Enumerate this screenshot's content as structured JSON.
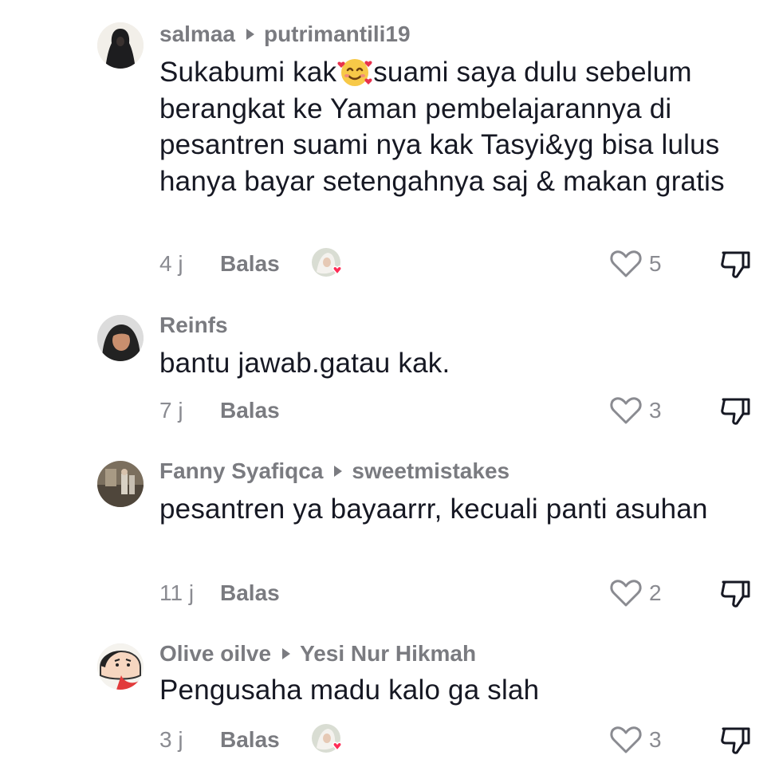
{
  "comments": [
    {
      "author": "salmaa",
      "reply_to": "putrimantili19",
      "text_before_emoji": "Sukabumi kak",
      "emoji": "smiling-face-with-hearts",
      "text_after_emoji": "suami saya dulu sebelum berangkat ke Yaman pembelajarannya di pesantren suami nya kak Tasyi&yg bisa lulus hanya bayar setengahnya saj & makan gratis",
      "time": "4 j",
      "reply_label": "Balas",
      "creator_liked": true,
      "likes": "5"
    },
    {
      "author": "Reinfs",
      "reply_to": "",
      "text": "bantu jawab.gatau kak.",
      "time": "7 j",
      "reply_label": "Balas",
      "creator_liked": false,
      "likes": "3"
    },
    {
      "author": "Fanny Syafiqca",
      "reply_to": "sweetmistakes",
      "text": "pesantren ya bayaarrr, kecuali panti asuhan",
      "time": "11 j",
      "reply_label": "Balas",
      "creator_liked": false,
      "likes": "2"
    },
    {
      "author": "Olive oilve",
      "reply_to": "Yesi Nur Hikmah",
      "text": "Pengusaha madu kalo ga slah",
      "time": "3 j",
      "reply_label": "Balas",
      "creator_liked": true,
      "likes": "3"
    }
  ],
  "colors": {
    "text": "#161823",
    "muted": "#7a7b80",
    "heart_badge": "#fe2c55"
  },
  "icons": [
    "heart-icon",
    "thumbs-down-icon",
    "reply-arrow-icon",
    "creator-liked-avatar-icon"
  ]
}
